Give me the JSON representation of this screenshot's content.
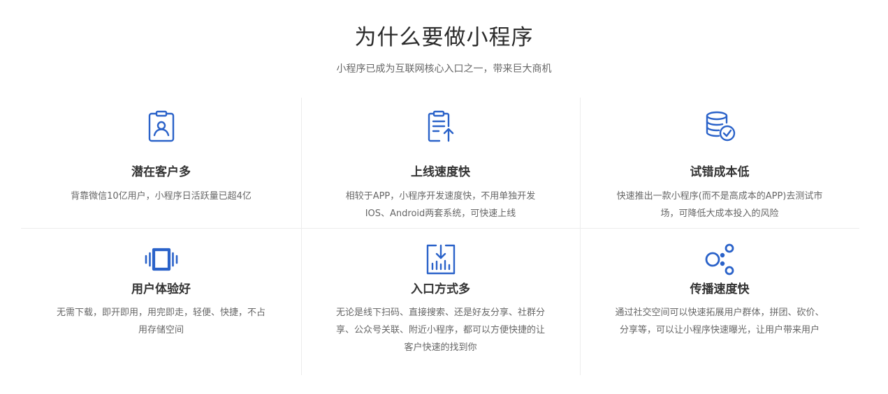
{
  "header": {
    "title": "为什么要做小程序",
    "subtitle": "小程序已成为互联网核心入口之一，带来巨大商机"
  },
  "theme": {
    "accent": "#2a62c9",
    "divider": "#ececec",
    "title_color": "#333333",
    "desc_color": "#666666"
  },
  "features": [
    {
      "icon": "badge-user-icon",
      "title": "潜在客户多",
      "desc": "背靠微信10亿用户，小程序日活跃量已超4亿"
    },
    {
      "icon": "document-upload-icon",
      "title": "上线速度快",
      "desc": "相较于APP，小程序开发速度快，不用单独开发IOS、Android两套系统，可快速上线"
    },
    {
      "icon": "database-check-icon",
      "title": "试错成本低",
      "desc": "快速推出一款小程序(而不是高成本的APP)去测试市场，可降低大成本投入的风险"
    },
    {
      "icon": "vibrate-frame-icon",
      "title": "用户体验好",
      "desc": "无需下载，即开即用，用完即走，轻便、快捷，不占用存储空间"
    },
    {
      "icon": "chart-download-icon",
      "title": "入口方式多",
      "desc": "无论是线下扫码、直接搜索、还是好友分享、社群分享、公众号关联、附近小程序，都可以方便快捷的让客户快速的找到你"
    },
    {
      "icon": "share-nodes-icon",
      "title": "传播速度快",
      "desc": "通过社交空间可以快速拓展用户群体，拼团、砍价、分享等，可以让小程序快速曝光，让用户带来用户"
    }
  ]
}
